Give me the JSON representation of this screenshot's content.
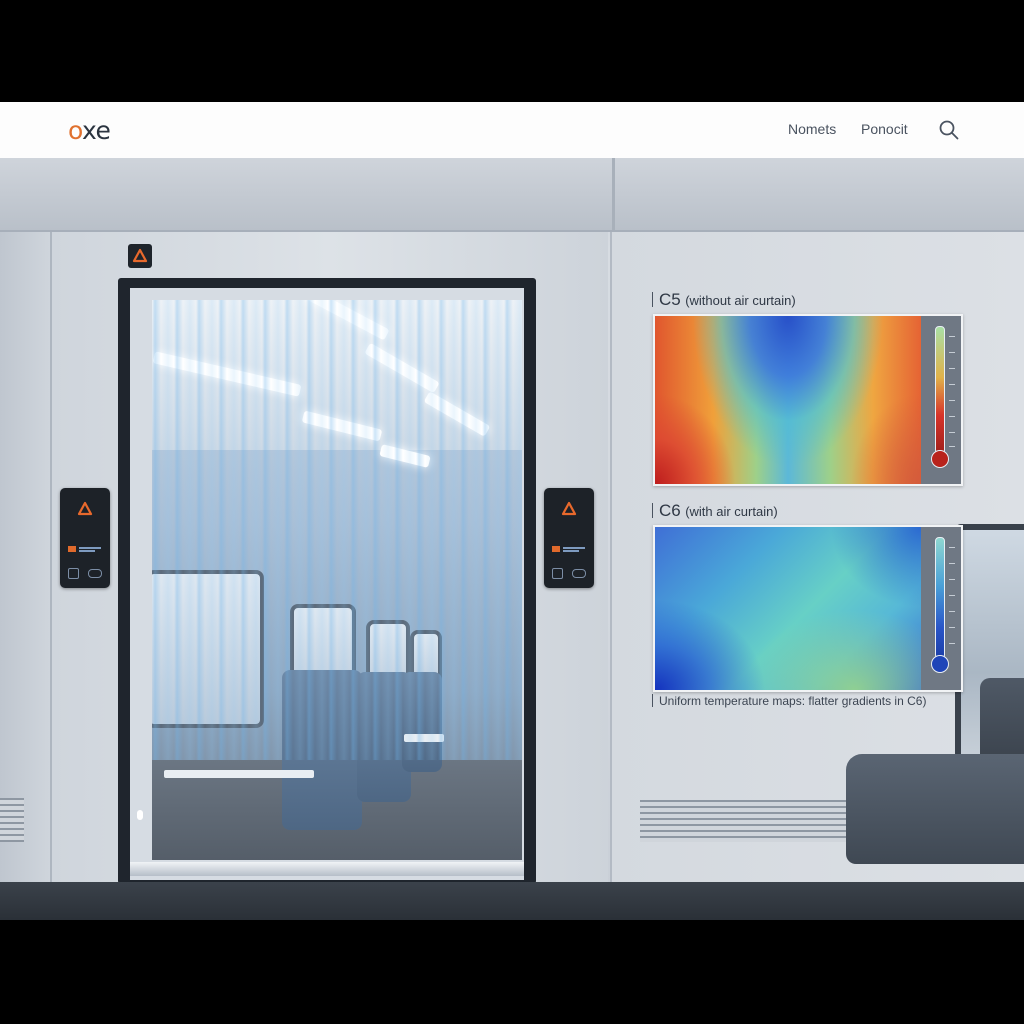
{
  "header": {
    "logo_prefix": "o",
    "logo_rest": "xe",
    "nav": [
      "Nomets",
      "Ponocit"
    ]
  },
  "icons": {
    "search": "search-icon",
    "warning": "warning-triangle-icon",
    "thermometer": "thermometer-icon"
  },
  "colors": {
    "accent": "#e0712f",
    "warm": "#d8342a",
    "cool": "#2a55c8"
  },
  "heatmaps": {
    "c5": {
      "id": "C5",
      "subtitle": "(without air curtain)"
    },
    "c6": {
      "id": "C6",
      "subtitle": "(with air curtain)"
    },
    "caption": "Uniform temperature maps: flatter gradients in C6)"
  }
}
